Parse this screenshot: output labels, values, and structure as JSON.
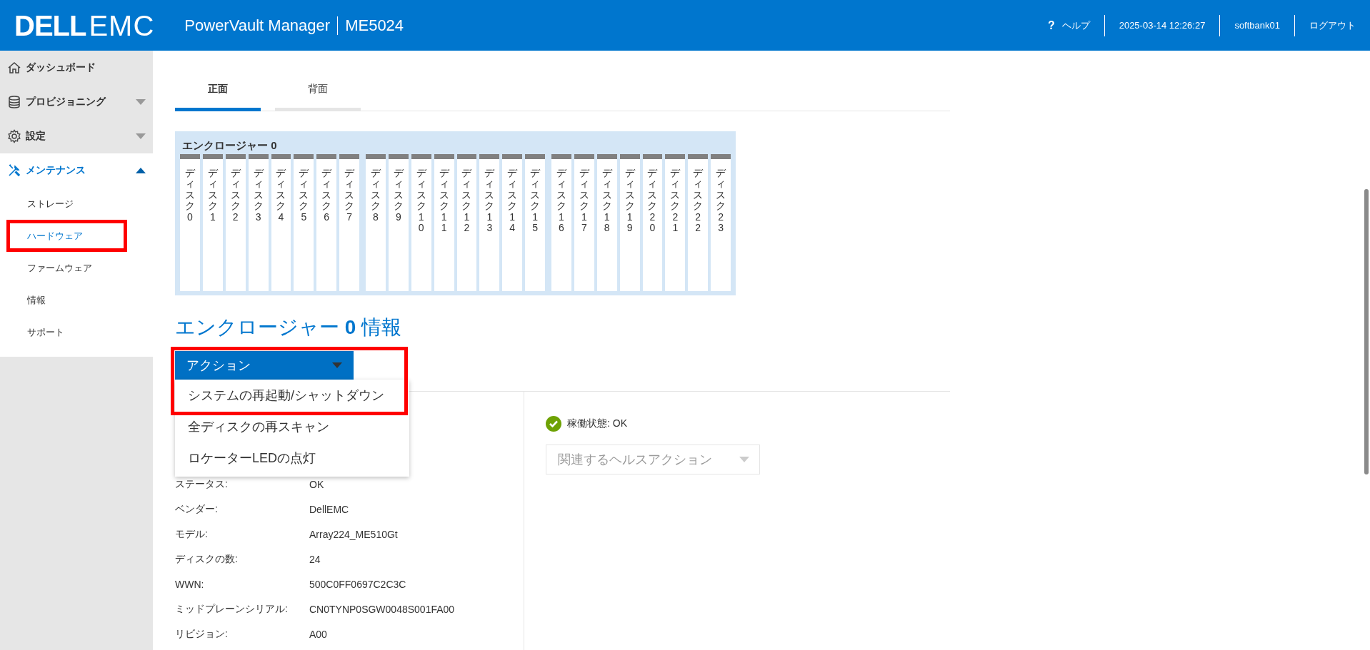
{
  "header": {
    "logo": {
      "brand": "DELL",
      "suffix": "EMC"
    },
    "product": "PowerVault Manager",
    "model": "ME5024",
    "help": {
      "icon": "?",
      "label": "ヘルプ"
    },
    "datetime": "2025-03-14 12:26:27",
    "user": "softbank01",
    "logout": "ログアウト"
  },
  "sidebar": {
    "items": [
      {
        "kind": "dashboard",
        "label": "ダッシュボード",
        "expandable": false,
        "expanded": false
      },
      {
        "kind": "provisioning",
        "label": "プロビジョニング",
        "expandable": true,
        "expanded": false
      },
      {
        "kind": "settings",
        "label": "設定",
        "expandable": true,
        "expanded": false
      },
      {
        "kind": "maintenance",
        "label": "メンテナンス",
        "expandable": true,
        "expanded": true,
        "children": [
          {
            "label": "ストレージ",
            "selected": false,
            "highlighted": false
          },
          {
            "label": "ハードウェア",
            "selected": true,
            "highlighted": true
          },
          {
            "label": "ファームウェア",
            "selected": false,
            "highlighted": false
          },
          {
            "label": "情報",
            "selected": false,
            "highlighted": false
          },
          {
            "label": "サポート",
            "selected": false,
            "highlighted": false
          }
        ]
      }
    ]
  },
  "tabs": [
    {
      "label": "正面",
      "selected": true
    },
    {
      "label": "背面",
      "selected": false
    }
  ],
  "enclosure": {
    "title": "エンクロージャー 0",
    "disks": [
      "ディスク0",
      "ディスク1",
      "ディスク2",
      "ディスク3",
      "ディスク4",
      "ディスク5",
      "ディスク6",
      "ディスク7",
      "ディスク8",
      "ディスク9",
      "ディスク10",
      "ディスク11",
      "ディスク12",
      "ディスク13",
      "ディスク14",
      "ディスク15",
      "ディスク16",
      "ディスク17",
      "ディスク18",
      "ディスク19",
      "ディスク20",
      "ディスク21",
      "ディスク22",
      "ディスク23"
    ]
  },
  "info_heading": "エンクロージャー **0** 情報",
  "actions": {
    "label": "アクション",
    "expanded": true,
    "highlighted": true,
    "menu": [
      {
        "label": "システムの再起動/シャットダウン"
      },
      {
        "label": "全ディスクの再スキャン"
      },
      {
        "label": "ロケーターLEDの点灯"
      }
    ]
  },
  "properties": [
    {
      "label": "ステータス:",
      "value": "OK"
    },
    {
      "label": "ベンダー:",
      "value": "DellEMC"
    },
    {
      "label": "モデル:",
      "value": "Array224_ME510Gt"
    },
    {
      "label": "ディスクの数:",
      "value": "24"
    },
    {
      "label": "WWN:",
      "value": "500C0FF0697C2C3C"
    },
    {
      "label": "ミッドプレーンシリアル:",
      "value": "CN0TYNP0SGW0048S001FA00"
    },
    {
      "label": "リビジョン:",
      "value": "A00"
    }
  ],
  "health": {
    "label": "稼働状態: OK",
    "ok": true
  },
  "health_action": {
    "placeholder": "関連するヘルスアクション",
    "disabled": true
  }
}
